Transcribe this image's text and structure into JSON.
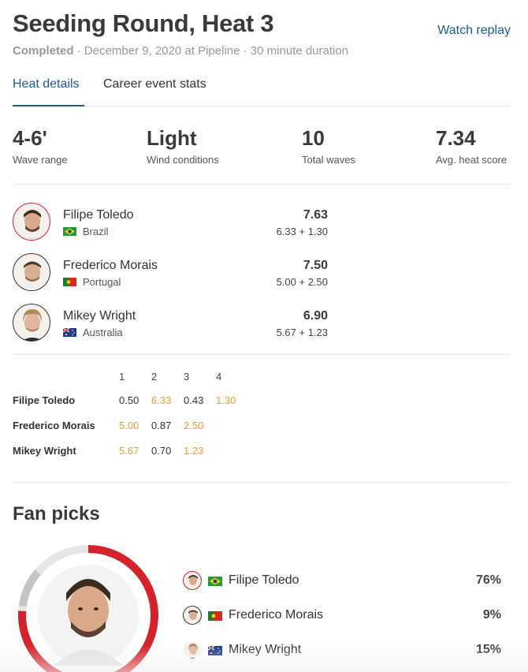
{
  "header": {
    "title": "Seeding Round, Heat 3",
    "watch_replay": "Watch replay",
    "status": "Completed",
    "meta_rest": " · December 9, 2020 at Pipeline · 30 minute duration"
  },
  "tabs": [
    {
      "label": "Heat details",
      "active": true
    },
    {
      "label": "Career event stats",
      "active": false
    }
  ],
  "stats": [
    {
      "value": "4-6'",
      "label": "Wave range"
    },
    {
      "value": "Light",
      "label": "Wind conditions"
    },
    {
      "value": "10",
      "label": "Total waves"
    },
    {
      "value": "7.34",
      "label": "Avg. heat score"
    }
  ],
  "surfers": [
    {
      "name": "Filipe Toledo",
      "country": "Brazil",
      "flag": "brazil-flag-icon",
      "total": "7.63",
      "breakdown": "6.33 + 1.30"
    },
    {
      "name": "Frederico Morais",
      "country": "Portugal",
      "flag": "portugal-flag-icon",
      "total": "7.50",
      "breakdown": "5.00 + 2.50"
    },
    {
      "name": "Mikey Wright",
      "country": "Australia",
      "flag": "australia-flag-icon",
      "total": "6.90",
      "breakdown": "5.67 + 1.23"
    }
  ],
  "waves": {
    "headers": [
      "1",
      "2",
      "3",
      "4"
    ],
    "rows": [
      {
        "name": "Filipe Toledo",
        "scores": [
          "0.50",
          "6.33",
          "0.43",
          "1.30"
        ],
        "counting": [
          false,
          true,
          false,
          true
        ]
      },
      {
        "name": "Frederico Morais",
        "scores": [
          "5.00",
          "0.87",
          "2.50"
        ],
        "counting": [
          true,
          false,
          true
        ]
      },
      {
        "name": "Mikey Wright",
        "scores": [
          "5.67",
          "0.70",
          "1.23"
        ],
        "counting": [
          true,
          false,
          true
        ]
      }
    ],
    "highlight_color": "#f39c2b"
  },
  "fan_picks": {
    "title": "Fan picks",
    "picks": [
      {
        "name": "Filipe Toledo",
        "pct": "76%",
        "share": 0.76
      },
      {
        "name": "Frederico Morais",
        "pct": "9%",
        "share": 0.09
      },
      {
        "name": "Mikey Wright",
        "pct": "15%",
        "share": 0.15
      }
    ]
  },
  "colors": {
    "accent": "#1f5a96",
    "leader": "#d5232b",
    "ring_rest": "#e6e6e6",
    "ring_mid": "#c4c4c4"
  }
}
